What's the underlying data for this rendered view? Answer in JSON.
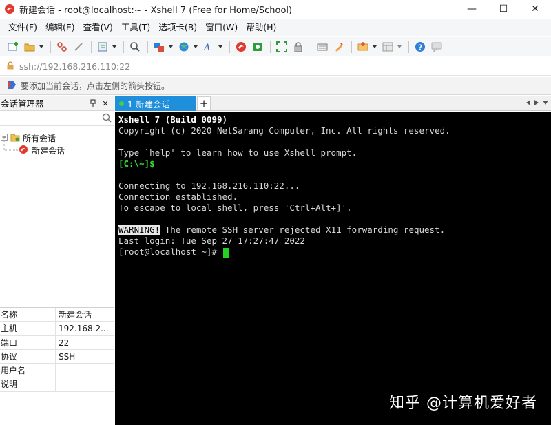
{
  "window": {
    "title": "新建会话 - root@localhost:~ - Xshell 7 (Free for Home/School)",
    "minimize_glyph": "—",
    "maximize_glyph": "☐",
    "close_glyph": "✕"
  },
  "menu": {
    "items": [
      "文件(F)",
      "编辑(E)",
      "查看(V)",
      "工具(T)",
      "选项卡(B)",
      "窗口(W)",
      "帮助(H)"
    ]
  },
  "toolbar": {
    "icons": [
      "new-session-icon",
      "open-folder-icon",
      "disconnect-icon",
      "reconnect-icon",
      "properties-icon",
      "find-icon",
      "new-window-icon",
      "globe-icon",
      "font-icon",
      "xftp-icon",
      "xmanager-icon",
      "fullscreen-icon",
      "lock-icon",
      "keyboard-icon",
      "highlight-icon",
      "compose-icon",
      "layout-icon",
      "help-icon",
      "chat-icon"
    ]
  },
  "address": {
    "text": "ssh://192.168.216.110:22"
  },
  "hint": {
    "text": "要添加当前会话，点击左侧的箭头按钮。"
  },
  "sidebar": {
    "title": "会话管理器",
    "pin_glyph": "📌",
    "close_glyph": "✕",
    "tree": {
      "root_label": "所有会话",
      "child_label": "新建会话"
    }
  },
  "properties": {
    "rows": [
      {
        "key": "名称",
        "value": "新建会话"
      },
      {
        "key": "主机",
        "value": "192.168.2..."
      },
      {
        "key": "端口",
        "value": "22"
      },
      {
        "key": "协议",
        "value": "SSH"
      },
      {
        "key": "用户名",
        "value": ""
      },
      {
        "key": "说明",
        "value": ""
      }
    ]
  },
  "tabs": {
    "active_label": "1 新建会话",
    "add_glyph": "+"
  },
  "terminal": {
    "line1": "Xshell 7 (Build 0099)",
    "line2": "Copyright (c) 2020 NetSarang Computer, Inc. All rights reserved.",
    "line3": "Type `help' to learn how to use Xshell prompt.",
    "prompt_local": "[C:\\~]$",
    "line5": "Connecting to 192.168.216.110:22...",
    "line6": "Connection established.",
    "line7": "To escape to local shell, press 'Ctrl+Alt+]'.",
    "warning_tag": "WARNING!",
    "warning_text": " The remote SSH server rejected X11 forwarding request.",
    "last_login": "Last login: Tue Sep 27 17:27:47 2022",
    "prompt_remote": "[root@localhost ~]# "
  },
  "watermark": "知乎 @计算机爱好者",
  "colors": {
    "tab_active": "#1f8fdc",
    "terminal_bg": "#000000",
    "prompt_green": "#33e033",
    "cursor_green": "#22d322"
  }
}
